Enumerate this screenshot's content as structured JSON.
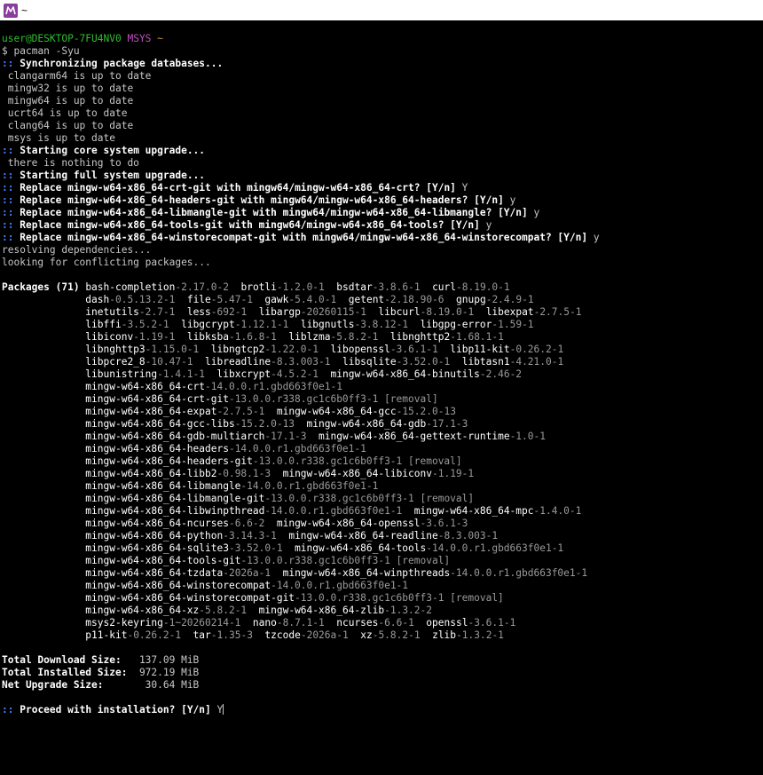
{
  "window": {
    "title": "~",
    "app_icon": "msys2-icon",
    "colors": {
      "background": "#000000",
      "titlebar": "#ffffff",
      "icon": "#8a3e9c",
      "text": "#c7c7c7",
      "bold_text": "#ffffff",
      "marker": "#4a7cff",
      "user": "#2fbf2f",
      "msystem": "#c04fc0",
      "path": "#c7a33a",
      "version": "#9a9a9a"
    }
  },
  "prompt": {
    "user_host": "user@DESKTOP-7FU4NV0",
    "msystem": "MSYS",
    "path": "~",
    "symbol": "$",
    "command": "pacman -Syu"
  },
  "lines_before_packages": [
    {
      "type": "header",
      "marker": "::",
      "text": "Synchronizing package databases..."
    },
    {
      "type": "plain",
      "text": " clangarm64 is up to date"
    },
    {
      "type": "plain",
      "text": " mingw32 is up to date"
    },
    {
      "type": "plain",
      "text": " mingw64 is up to date"
    },
    {
      "type": "plain",
      "text": " ucrt64 is up to date"
    },
    {
      "type": "plain",
      "text": " clang64 is up to date"
    },
    {
      "type": "plain",
      "text": " msys is up to date"
    },
    {
      "type": "header",
      "marker": "::",
      "text": "Starting core system upgrade..."
    },
    {
      "type": "plain",
      "text": " there is nothing to do"
    },
    {
      "type": "header",
      "marker": "::",
      "text": "Starting full system upgrade..."
    },
    {
      "type": "question",
      "marker": "::",
      "text": "Replace mingw-w64-x86_64-crt-git with mingw64/mingw-w64-x86_64-crt? [Y/n]",
      "answer": "Y"
    },
    {
      "type": "question",
      "marker": "::",
      "text": "Replace mingw-w64-x86_64-headers-git with mingw64/mingw-w64-x86_64-headers? [Y/n]",
      "answer": "y"
    },
    {
      "type": "question",
      "marker": "::",
      "text": "Replace mingw-w64-x86_64-libmangle-git with mingw64/mingw-w64-x86_64-libmangle? [Y/n]",
      "answer": "y"
    },
    {
      "type": "question",
      "marker": "::",
      "text": "Replace mingw-w64-x86_64-tools-git with mingw64/mingw-w64-x86_64-tools? [Y/n]",
      "answer": "y"
    },
    {
      "type": "question",
      "marker": "::",
      "text": "Replace mingw-w64-x86_64-winstorecompat-git with mingw64/mingw-w64-x86_64-winstorecompat? [Y/n]",
      "answer": "y"
    },
    {
      "type": "plain",
      "text": "resolving dependencies..."
    },
    {
      "type": "plain",
      "text": "looking for conflicting packages..."
    },
    {
      "type": "blank",
      "text": ""
    }
  ],
  "packages": {
    "label": "Packages (71)",
    "rows": [
      [
        [
          "bash-completion",
          "-2.17.0-2"
        ],
        [
          "brotli",
          "-1.2.0-1"
        ],
        [
          "bsdtar",
          "-3.8.6-1"
        ],
        [
          "curl",
          "-8.19.0-1"
        ]
      ],
      [
        [
          "dash",
          "-0.5.13.2-1"
        ],
        [
          "file",
          "-5.47-1"
        ],
        [
          "gawk",
          "-5.4.0-1"
        ],
        [
          "getent",
          "-2.18.90-6"
        ],
        [
          "gnupg",
          "-2.4.9-1"
        ]
      ],
      [
        [
          "inetutils",
          "-2.7-1"
        ],
        [
          "less",
          "-692-1"
        ],
        [
          "libargp",
          "-20260115-1"
        ],
        [
          "libcurl",
          "-8.19.0-1"
        ],
        [
          "libexpat",
          "-2.7.5-1"
        ]
      ],
      [
        [
          "libffi",
          "-3.5.2-1"
        ],
        [
          "libgcrypt",
          "-1.12.1-1"
        ],
        [
          "libgnutls",
          "-3.8.12-1"
        ],
        [
          "libgpg-error",
          "-1.59-1"
        ]
      ],
      [
        [
          "libiconv",
          "-1.19-1"
        ],
        [
          "libksba",
          "-1.6.8-1"
        ],
        [
          "liblzma",
          "-5.8.2-1"
        ],
        [
          "libnghttp2",
          "-1.68.1-1"
        ]
      ],
      [
        [
          "libnghttp3",
          "-1.15.0-1"
        ],
        [
          "libngtcp2",
          "-1.22.0-1"
        ],
        [
          "libopenssl",
          "-3.6.1-1"
        ],
        [
          "libp11-kit",
          "-0.26.2-1"
        ]
      ],
      [
        [
          "libpcre2_8",
          "-10.47-1"
        ],
        [
          "libreadline",
          "-8.3.003-1"
        ],
        [
          "libsqlite",
          "-3.52.0-1"
        ],
        [
          "libtasn1",
          "-4.21.0-1"
        ]
      ],
      [
        [
          "libunistring",
          "-1.4.1-1"
        ],
        [
          "libxcrypt",
          "-4.5.2-1"
        ],
        [
          "mingw-w64-x86_64-binutils",
          "-2.46-2"
        ]
      ],
      [
        [
          "mingw-w64-x86_64-crt",
          "-14.0.0.r1.gbd663f0e1-1"
        ]
      ],
      [
        [
          "mingw-w64-x86_64-crt-git",
          "-13.0.0.r338.gc1c6b0ff3-1 [removal]"
        ]
      ],
      [
        [
          "mingw-w64-x86_64-expat",
          "-2.7.5-1"
        ],
        [
          "mingw-w64-x86_64-gcc",
          "-15.2.0-13"
        ]
      ],
      [
        [
          "mingw-w64-x86_64-gcc-libs",
          "-15.2.0-13"
        ],
        [
          "mingw-w64-x86_64-gdb",
          "-17.1-3"
        ]
      ],
      [
        [
          "mingw-w64-x86_64-gdb-multiarch",
          "-17.1-3"
        ],
        [
          "mingw-w64-x86_64-gettext-runtime",
          "-1.0-1"
        ]
      ],
      [
        [
          "mingw-w64-x86_64-headers",
          "-14.0.0.r1.gbd663f0e1-1"
        ]
      ],
      [
        [
          "mingw-w64-x86_64-headers-git",
          "-13.0.0.r338.gc1c6b0ff3-1 [removal]"
        ]
      ],
      [
        [
          "mingw-w64-x86_64-libb2",
          "-0.98.1-3"
        ],
        [
          "mingw-w64-x86_64-libiconv",
          "-1.19-1"
        ]
      ],
      [
        [
          "mingw-w64-x86_64-libmangle",
          "-14.0.0.r1.gbd663f0e1-1"
        ]
      ],
      [
        [
          "mingw-w64-x86_64-libmangle-git",
          "-13.0.0.r338.gc1c6b0ff3-1 [removal]"
        ]
      ],
      [
        [
          "mingw-w64-x86_64-libwinpthread",
          "-14.0.0.r1.gbd663f0e1-1"
        ],
        [
          "mingw-w64-x86_64-mpc",
          "-1.4.0-1"
        ]
      ],
      [
        [
          "mingw-w64-x86_64-ncurses",
          "-6.6-2"
        ],
        [
          "mingw-w64-x86_64-openssl",
          "-3.6.1-3"
        ]
      ],
      [
        [
          "mingw-w64-x86_64-python",
          "-3.14.3-1"
        ],
        [
          "mingw-w64-x86_64-readline",
          "-8.3.003-1"
        ]
      ],
      [
        [
          "mingw-w64-x86_64-sqlite3",
          "-3.52.0-1"
        ],
        [
          "mingw-w64-x86_64-tools",
          "-14.0.0.r1.gbd663f0e1-1"
        ]
      ],
      [
        [
          "mingw-w64-x86_64-tools-git",
          "-13.0.0.r338.gc1c6b0ff3-1 [removal]"
        ]
      ],
      [
        [
          "mingw-w64-x86_64-tzdata",
          "-2026a-1"
        ],
        [
          "mingw-w64-x86_64-winpthreads",
          "-14.0.0.r1.gbd663f0e1-1"
        ]
      ],
      [
        [
          "mingw-w64-x86_64-winstorecompat",
          "-14.0.0.r1.gbd663f0e1-1"
        ]
      ],
      [
        [
          "mingw-w64-x86_64-winstorecompat-git",
          "-13.0.0.r338.gc1c6b0ff3-1 [removal]"
        ]
      ],
      [
        [
          "mingw-w64-x86_64-xz",
          "-5.8.2-1"
        ],
        [
          "mingw-w64-x86_64-zlib",
          "-1.3.2-2"
        ]
      ],
      [
        [
          "msys2-keyring",
          "-1~20260214-1"
        ],
        [
          "nano",
          "-8.7.1-1"
        ],
        [
          "ncurses",
          "-6.6-1"
        ],
        [
          "openssl",
          "-3.6.1-1"
        ]
      ],
      [
        [
          "p11-kit",
          "-0.26.2-1"
        ],
        [
          "tar",
          "-1.35-3"
        ],
        [
          "tzcode",
          "-2026a-1"
        ],
        [
          "xz",
          "-5.8.2-1"
        ],
        [
          "zlib",
          "-1.3.2-1"
        ]
      ]
    ]
  },
  "sizes": [
    {
      "label": "Total Download Size:",
      "value": "137.09 MiB"
    },
    {
      "label": "Total Installed Size:",
      "value": "972.19 MiB"
    },
    {
      "label": "Net Upgrade Size:",
      "value": "30.64 MiB"
    }
  ],
  "final_prompt": {
    "marker": "::",
    "text": "Proceed with installation? [Y/n]",
    "answer": "Y"
  }
}
